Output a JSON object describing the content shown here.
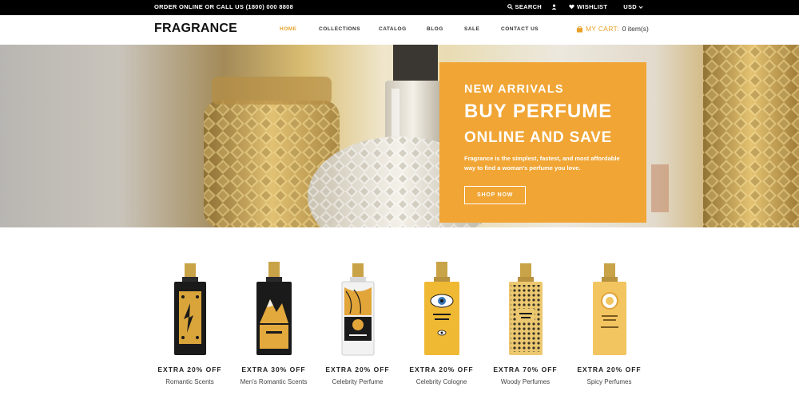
{
  "topbar": {
    "order_text": "ORDER ONLINE OR CALL US (1800) 000 8808",
    "search_label": "SEARCH",
    "wishlist_label": "WISHLIST",
    "currency": "USD"
  },
  "header": {
    "logo": "FRAGRANCE",
    "nav": [
      {
        "label": "HOME",
        "active": true
      },
      {
        "label": "COLLECTIONS"
      },
      {
        "label": "CATALOG"
      },
      {
        "label": "BLOG"
      },
      {
        "label": "SALE"
      },
      {
        "label": "CONTACT US"
      }
    ],
    "cart_label": "MY CART:",
    "cart_count": "0 item(s)"
  },
  "hero": {
    "kicker": "NEW ARRIVALS",
    "title_line1": "BUY PERFUME",
    "title_line2": "ONLINE AND SAVE",
    "description": "Fragrance is the simplest, fastest, and most affordable way to find a woman's perfume you love.",
    "button": "SHOP NOW"
  },
  "products": [
    {
      "offer": "EXTRA 20% OFF",
      "category": "Romantic Scents"
    },
    {
      "offer": "EXTRA 30% OFF",
      "category": "Men's Romantic Scents"
    },
    {
      "offer": "EXTRA 20% OFF",
      "category": "Celebrity Perfume"
    },
    {
      "offer": "EXTRA 20% OFF",
      "category": "Celebrity Cologne"
    },
    {
      "offer": "EXTRA 70% OFF",
      "category": "Woody Perfumes"
    },
    {
      "offer": "EXTRA 20% OFF",
      "category": "Spicy Perfumes"
    }
  ],
  "colors": {
    "accent": "#f0a534",
    "nav_active": "#e9a12a",
    "topbar_bg": "#000000"
  }
}
